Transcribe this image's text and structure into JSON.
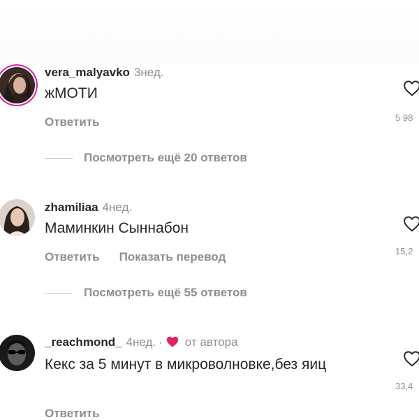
{
  "comments": [
    {
      "username": "vera_malyavko",
      "time": "3нед.",
      "text": "жМОТИ",
      "reply_label": "Ответить",
      "likes": "5 98",
      "replies_label": "Посмотреть ещё 20 ответов",
      "avatar_icon": "profile-photo"
    },
    {
      "username": "zhamiliaa",
      "time": "4нед.",
      "text": "Маминкин Сыннабон",
      "reply_label": "Ответить",
      "translate_label": "Показать перевод",
      "likes": "15,2",
      "replies_label": "Посмотреть ещё 55 ответов",
      "avatar_icon": "profile-photo"
    },
    {
      "username": "_reachmond_",
      "time": "4нед.",
      "separator": "·",
      "author_label": "от автора",
      "text": "Кекс за 5 минут в микроволновке,без яиц",
      "reply_label": "Ответить",
      "likes": "33,4",
      "avatar_icon": "profile-photo"
    }
  ],
  "colors": {
    "primary_text": "#262626",
    "secondary_text": "#8e8e8e",
    "heart_red": "#e0245e",
    "story_ring": "#d6249f"
  }
}
